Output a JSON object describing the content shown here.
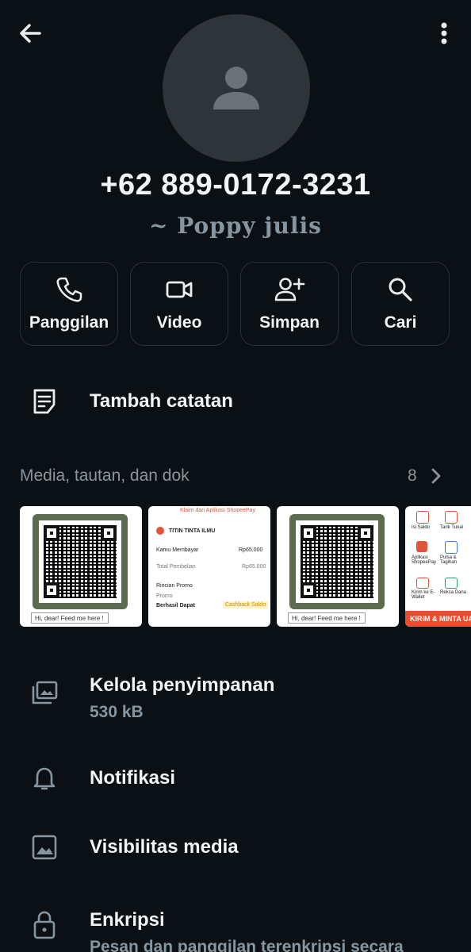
{
  "header": {
    "back_icon": "arrow-left-icon",
    "menu_icon": "more-vertical-icon",
    "avatar_icon": "person-icon"
  },
  "contact": {
    "phone": "+62 889-0172-3231",
    "push_name": "~ Poppy julis"
  },
  "actions": [
    {
      "label": "Panggilan",
      "icon": "phone-icon"
    },
    {
      "label": "Video",
      "icon": "video-camera-icon"
    },
    {
      "label": "Simpan",
      "icon": "add-person-icon"
    },
    {
      "label": "Cari",
      "icon": "search-icon"
    }
  ],
  "note": {
    "label": "Tambah catatan",
    "icon": "note-icon"
  },
  "media": {
    "label": "Media, tautan, dan dok",
    "count": "8",
    "thumbs": [
      {
        "caption": "Hi, dear! Feed me here ! ^^"
      },
      {
        "top_banner": "Klaim dari Aplikasi ShopeePay",
        "merchant": "TITIN TINTA ILMU",
        "paid_label": "Kamu Membayar",
        "paid_value": "Rp65.000",
        "total_label": "Total Pembelian",
        "total_value": "Rp65.000",
        "promo_title": "Rincian Promo",
        "promo_label": "Promo",
        "promo_status": "Berhasil Dapat",
        "promo_badge": "Cashback Saldo"
      },
      {
        "caption": "Hi, dear! Feed me here ! ^^"
      },
      {
        "items": [
          "Isi Saldo",
          "Tarik Tunai",
          "Aplikasi ShopeePay",
          "Pulsa & Tagihan",
          "Kirim ke E-Wallet",
          "Reksa Dana"
        ],
        "banner": "KIRIM & MINTA UA"
      }
    ]
  },
  "settings": [
    {
      "title": "Kelola penyimpanan",
      "subtitle": "530 kB",
      "icon": "storage-folder-icon"
    },
    {
      "title": "Notifikasi",
      "icon": "bell-icon"
    },
    {
      "title": "Visibilitas media",
      "icon": "image-icon"
    },
    {
      "title": "Enkripsi",
      "subtitle": "Pesan dan panggilan terenkripsi secara",
      "icon": "lock-icon"
    }
  ],
  "colors": {
    "background": "#0b1014",
    "text": "#e9edef",
    "muted": "#8696a0",
    "avatar_bg": "#2f3438"
  }
}
